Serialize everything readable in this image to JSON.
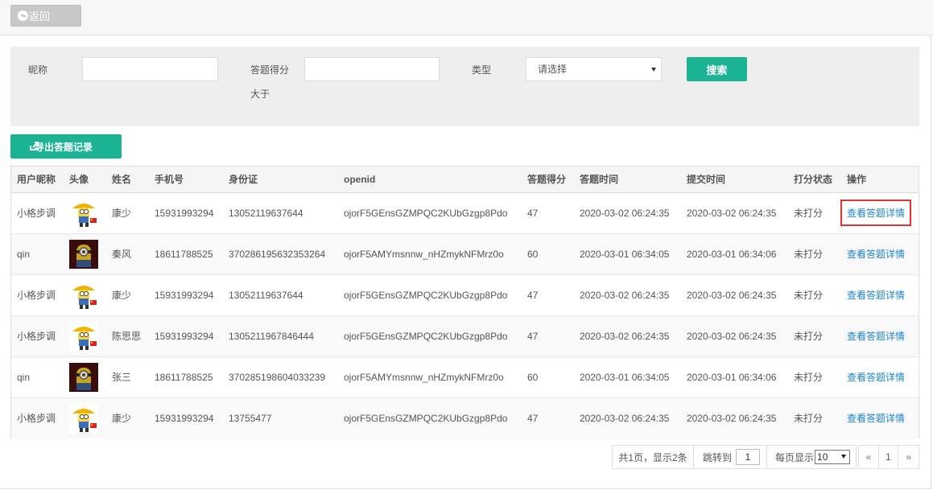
{
  "toolbar": {
    "back_label": "返回"
  },
  "search": {
    "nickname_label": "昵称",
    "nickname_value": "",
    "score_label": "答题得分",
    "score_sub_label": "大于",
    "score_value": "",
    "type_label": "类型",
    "type_selected": "请选择",
    "search_label": "搜索"
  },
  "actions": {
    "export_label": "导出答题记录"
  },
  "table": {
    "columns": [
      "用户昵称",
      "头像",
      "姓名",
      "手机号",
      "身份证",
      "openid",
      "答题得分",
      "答题时间",
      "提交时间",
      "打分状态",
      "操作"
    ],
    "rows": [
      {
        "nickname": "小格步调",
        "avatar": "minion-yellow-hat",
        "name": "康少",
        "phone": "15931993294",
        "idcard": "13052119637644",
        "openid": "ojorF5GEnsGZMPQC2KUbGzgp8Pdo",
        "score": "47",
        "answer_time": "2020-03-02 06:24:35",
        "submit_time": "2020-03-02 06:24:35",
        "status": "未打分",
        "action": "查看答题详情"
      },
      {
        "nickname": "qin",
        "avatar": "minion-dark-red",
        "name": "秦风",
        "phone": "18611788525",
        "idcard": "370286195632353264",
        "openid": "ojorF5AMYmsnnw_nHZmykNFMrz0o",
        "score": "60",
        "answer_time": "2020-03-01 06:34:05",
        "submit_time": "2020-03-01 06:34:06",
        "status": "未打分",
        "action": "查看答题详情"
      },
      {
        "nickname": "小格步调",
        "avatar": "minion-yellow-hat",
        "name": "康少",
        "phone": "15931993294",
        "idcard": "13052119637644",
        "openid": "ojorF5GEnsGZMPQC2KUbGzgp8Pdo",
        "score": "47",
        "answer_time": "2020-03-02 06:24:35",
        "submit_time": "2020-03-02 06:24:35",
        "status": "未打分",
        "action": "查看答题详情"
      },
      {
        "nickname": "小格步调",
        "avatar": "minion-yellow-hat",
        "name": "陈思思",
        "phone": "15931993294",
        "idcard": "1305211967846444",
        "openid": "ojorF5GEnsGZMPQC2KUbGzgp8Pdo",
        "score": "47",
        "answer_time": "2020-03-02 06:24:35",
        "submit_time": "2020-03-02 06:24:35",
        "status": "未打分",
        "action": "查看答题详情"
      },
      {
        "nickname": "qin",
        "avatar": "minion-dark-red",
        "name": "张三",
        "phone": "18611788525",
        "idcard": "370285198604033239",
        "openid": "ojorF5AMYmsnnw_nHZmykNFMrz0o",
        "score": "60",
        "answer_time": "2020-03-01 06:34:05",
        "submit_time": "2020-03-01 06:34:06",
        "status": "未打分",
        "action": "查看答题详情"
      },
      {
        "nickname": "小格步调",
        "avatar": "minion-yellow-hat",
        "name": "康少",
        "phone": "15931993294",
        "idcard": "13755477",
        "openid": "ojorF5GEnsGZMPQC2KUbGzgp8Pdo",
        "score": "47",
        "answer_time": "2020-03-02 06:24:35",
        "submit_time": "2020-03-02 06:24:35",
        "status": "未打分",
        "action": "查看答题详情"
      }
    ]
  },
  "pagination": {
    "info": "共1页，显示2条",
    "jump_label": "跳转到",
    "jump_value": "1",
    "page_size_label": "每页显示",
    "page_size_value": "10",
    "prev": "«",
    "current_page": "1",
    "next": "»"
  },
  "colors": {
    "accent": "#1ab394",
    "link": "#1c84c6",
    "highlight": "#e03434"
  }
}
